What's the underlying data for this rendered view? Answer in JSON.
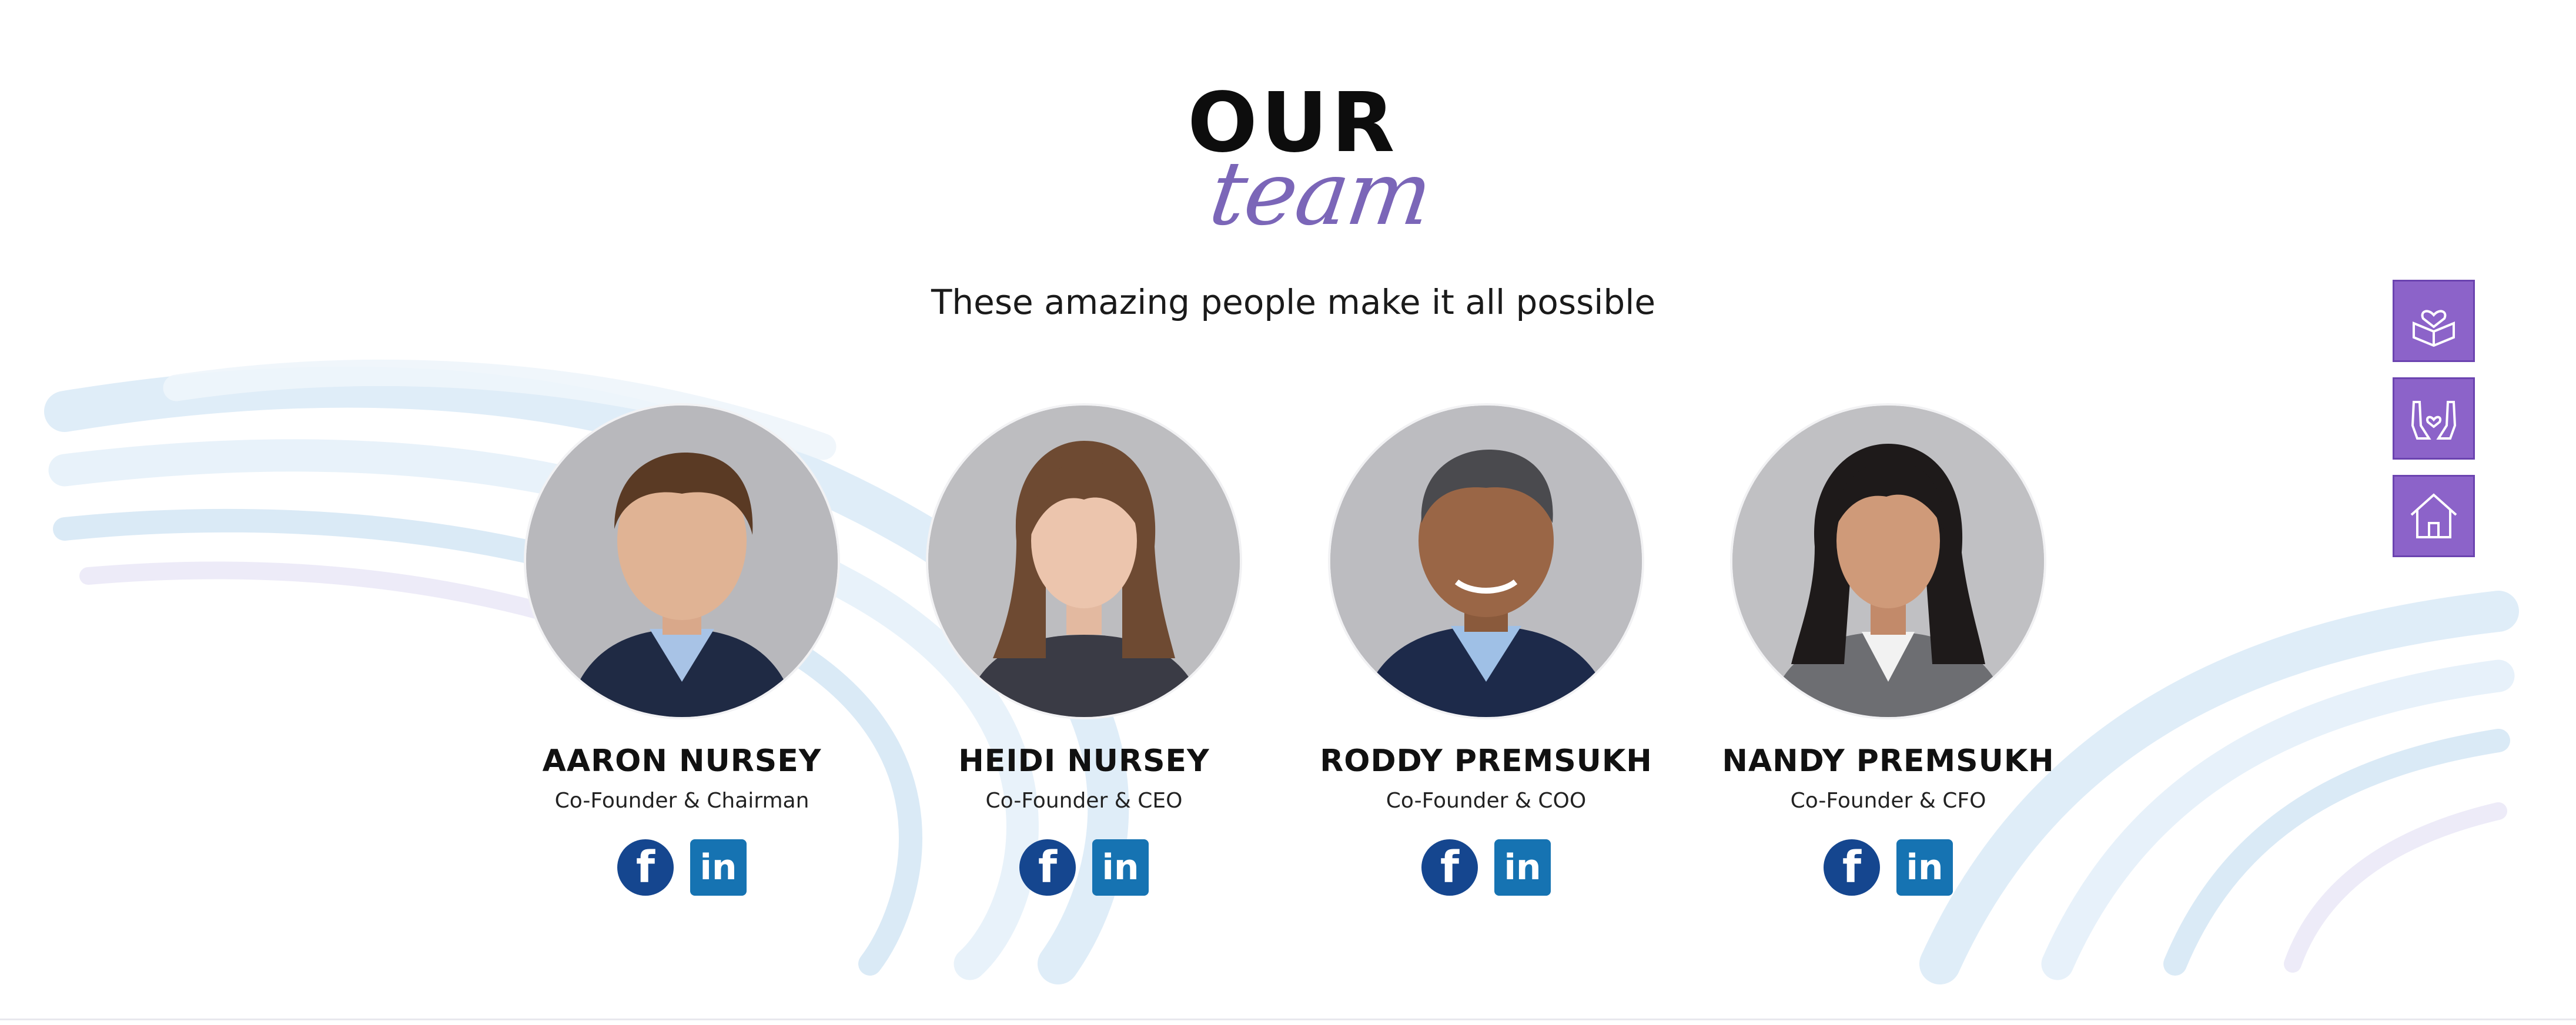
{
  "heading": {
    "line1": "OUR",
    "line2": "team"
  },
  "subtitle": "These amazing people make it all possible",
  "team": [
    {
      "name": "AARON NURSEY",
      "role": "Co-Founder & Chairman",
      "facebook_label": "f",
      "linkedin_label": "in"
    },
    {
      "name": "HEIDI NURSEY",
      "role": "Co-Founder & CEO",
      "facebook_label": "f",
      "linkedin_label": "in"
    },
    {
      "name": "RODDY PREMSUKH",
      "role": "Co-Founder & COO",
      "facebook_label": "f",
      "linkedin_label": "in"
    },
    {
      "name": "NANDY PREMSUKH",
      "role": "Co-Founder & CFO",
      "facebook_label": "f",
      "linkedin_label": "in"
    }
  ],
  "side_buttons": [
    {
      "icon": "heart-box-icon"
    },
    {
      "icon": "hands-heart-icon"
    },
    {
      "icon": "home-icon"
    }
  ],
  "colors": {
    "accent_purple": "#8c63c9",
    "heading_script": "#7b66b8",
    "facebook_blue": "#15468f",
    "linkedin_blue": "#1673b2",
    "swirl": "#cfe6f5"
  }
}
